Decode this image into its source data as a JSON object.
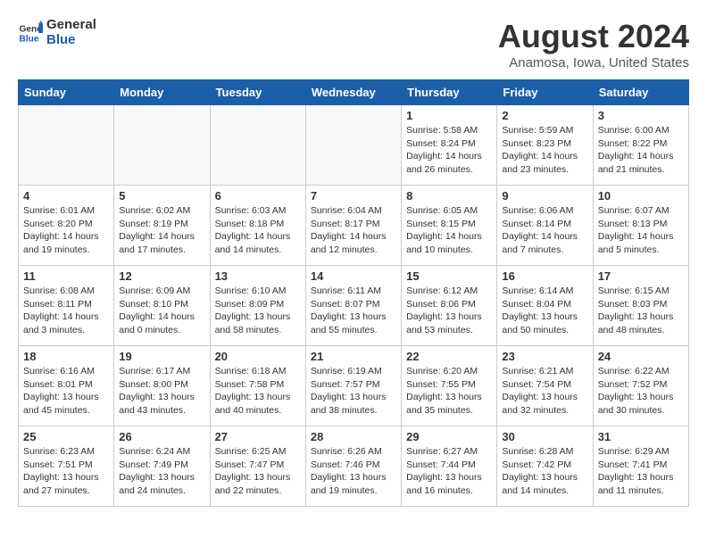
{
  "logo": {
    "general": "General",
    "blue": "Blue"
  },
  "title": "August 2024",
  "location": "Anamosa, Iowa, United States",
  "weekdays": [
    "Sunday",
    "Monday",
    "Tuesday",
    "Wednesday",
    "Thursday",
    "Friday",
    "Saturday"
  ],
  "weeks": [
    [
      {
        "day": "",
        "info": ""
      },
      {
        "day": "",
        "info": ""
      },
      {
        "day": "",
        "info": ""
      },
      {
        "day": "",
        "info": ""
      },
      {
        "day": "1",
        "info": "Sunrise: 5:58 AM\nSunset: 8:24 PM\nDaylight: 14 hours\nand 26 minutes."
      },
      {
        "day": "2",
        "info": "Sunrise: 5:59 AM\nSunset: 8:23 PM\nDaylight: 14 hours\nand 23 minutes."
      },
      {
        "day": "3",
        "info": "Sunrise: 6:00 AM\nSunset: 8:22 PM\nDaylight: 14 hours\nand 21 minutes."
      }
    ],
    [
      {
        "day": "4",
        "info": "Sunrise: 6:01 AM\nSunset: 8:20 PM\nDaylight: 14 hours\nand 19 minutes."
      },
      {
        "day": "5",
        "info": "Sunrise: 6:02 AM\nSunset: 8:19 PM\nDaylight: 14 hours\nand 17 minutes."
      },
      {
        "day": "6",
        "info": "Sunrise: 6:03 AM\nSunset: 8:18 PM\nDaylight: 14 hours\nand 14 minutes."
      },
      {
        "day": "7",
        "info": "Sunrise: 6:04 AM\nSunset: 8:17 PM\nDaylight: 14 hours\nand 12 minutes."
      },
      {
        "day": "8",
        "info": "Sunrise: 6:05 AM\nSunset: 8:15 PM\nDaylight: 14 hours\nand 10 minutes."
      },
      {
        "day": "9",
        "info": "Sunrise: 6:06 AM\nSunset: 8:14 PM\nDaylight: 14 hours\nand 7 minutes."
      },
      {
        "day": "10",
        "info": "Sunrise: 6:07 AM\nSunset: 8:13 PM\nDaylight: 14 hours\nand 5 minutes."
      }
    ],
    [
      {
        "day": "11",
        "info": "Sunrise: 6:08 AM\nSunset: 8:11 PM\nDaylight: 14 hours\nand 3 minutes."
      },
      {
        "day": "12",
        "info": "Sunrise: 6:09 AM\nSunset: 8:10 PM\nDaylight: 14 hours\nand 0 minutes."
      },
      {
        "day": "13",
        "info": "Sunrise: 6:10 AM\nSunset: 8:09 PM\nDaylight: 13 hours\nand 58 minutes."
      },
      {
        "day": "14",
        "info": "Sunrise: 6:11 AM\nSunset: 8:07 PM\nDaylight: 13 hours\nand 55 minutes."
      },
      {
        "day": "15",
        "info": "Sunrise: 6:12 AM\nSunset: 8:06 PM\nDaylight: 13 hours\nand 53 minutes."
      },
      {
        "day": "16",
        "info": "Sunrise: 6:14 AM\nSunset: 8:04 PM\nDaylight: 13 hours\nand 50 minutes."
      },
      {
        "day": "17",
        "info": "Sunrise: 6:15 AM\nSunset: 8:03 PM\nDaylight: 13 hours\nand 48 minutes."
      }
    ],
    [
      {
        "day": "18",
        "info": "Sunrise: 6:16 AM\nSunset: 8:01 PM\nDaylight: 13 hours\nand 45 minutes."
      },
      {
        "day": "19",
        "info": "Sunrise: 6:17 AM\nSunset: 8:00 PM\nDaylight: 13 hours\nand 43 minutes."
      },
      {
        "day": "20",
        "info": "Sunrise: 6:18 AM\nSunset: 7:58 PM\nDaylight: 13 hours\nand 40 minutes."
      },
      {
        "day": "21",
        "info": "Sunrise: 6:19 AM\nSunset: 7:57 PM\nDaylight: 13 hours\nand 38 minutes."
      },
      {
        "day": "22",
        "info": "Sunrise: 6:20 AM\nSunset: 7:55 PM\nDaylight: 13 hours\nand 35 minutes."
      },
      {
        "day": "23",
        "info": "Sunrise: 6:21 AM\nSunset: 7:54 PM\nDaylight: 13 hours\nand 32 minutes."
      },
      {
        "day": "24",
        "info": "Sunrise: 6:22 AM\nSunset: 7:52 PM\nDaylight: 13 hours\nand 30 minutes."
      }
    ],
    [
      {
        "day": "25",
        "info": "Sunrise: 6:23 AM\nSunset: 7:51 PM\nDaylight: 13 hours\nand 27 minutes."
      },
      {
        "day": "26",
        "info": "Sunrise: 6:24 AM\nSunset: 7:49 PM\nDaylight: 13 hours\nand 24 minutes."
      },
      {
        "day": "27",
        "info": "Sunrise: 6:25 AM\nSunset: 7:47 PM\nDaylight: 13 hours\nand 22 minutes."
      },
      {
        "day": "28",
        "info": "Sunrise: 6:26 AM\nSunset: 7:46 PM\nDaylight: 13 hours\nand 19 minutes."
      },
      {
        "day": "29",
        "info": "Sunrise: 6:27 AM\nSunset: 7:44 PM\nDaylight: 13 hours\nand 16 minutes."
      },
      {
        "day": "30",
        "info": "Sunrise: 6:28 AM\nSunset: 7:42 PM\nDaylight: 13 hours\nand 14 minutes."
      },
      {
        "day": "31",
        "info": "Sunrise: 6:29 AM\nSunset: 7:41 PM\nDaylight: 13 hours\nand 11 minutes."
      }
    ]
  ]
}
